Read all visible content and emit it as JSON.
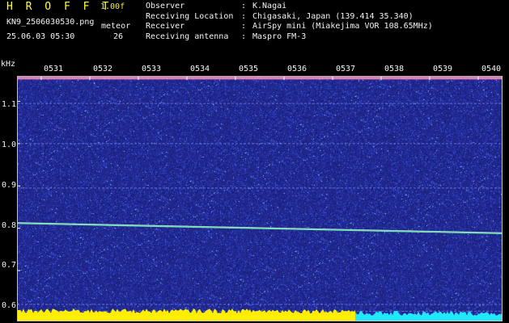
{
  "app": {
    "title": "H R O F F T",
    "version": "1.00f"
  },
  "capture": {
    "file_name": "KN9_2506030530.png",
    "date_time": "25.06.03 05:30",
    "meteor_label": "meteor",
    "meteor_count": "26"
  },
  "station_info": [
    {
      "key": "Observer",
      "value": "K.Nagai"
    },
    {
      "key": "Receiving Location",
      "value": "Chigasaki, Japan (139.414 35.340)"
    },
    {
      "key": "Receiver",
      "value": "AirSpy mini (Miakejima VOR 108.65MHz)"
    },
    {
      "key": "Receiving antenna",
      "value": "Maspro FM-3"
    }
  ],
  "separator": ":",
  "chart_data": {
    "type": "heatmap",
    "ylabel": "kHz",
    "x_tick_labels": [
      "0531",
      "0532",
      "0533",
      "0534",
      "0535",
      "0536",
      "0537",
      "0538",
      "0539",
      "0540"
    ],
    "y_tick_labels": [
      "1.1",
      "1.0",
      "0.9",
      "0.8",
      "0.7",
      "0.6"
    ],
    "y_ticks_khz": [
      1.1,
      1.0,
      0.9,
      0.8,
      0.7,
      0.6
    ],
    "ylim_khz": [
      0.58,
      1.16
    ],
    "x_range_min": [
      30.5,
      40.5
    ],
    "carrier_khz": 1.155,
    "horizontal_lines_khz": [
      1.095,
      1.0,
      0.895,
      0.62,
      0.604
    ],
    "drifting_signal": {
      "start_khz": 0.812,
      "end_khz": 0.788
    },
    "colors": {
      "background": "#202890",
      "noise": "#3a4cd8",
      "signal": "#7cf0b0",
      "carrier": "#ff6fa8",
      "bottom_trace": "#ffee00",
      "bottom_trace_alt": "#20e8ff"
    }
  }
}
